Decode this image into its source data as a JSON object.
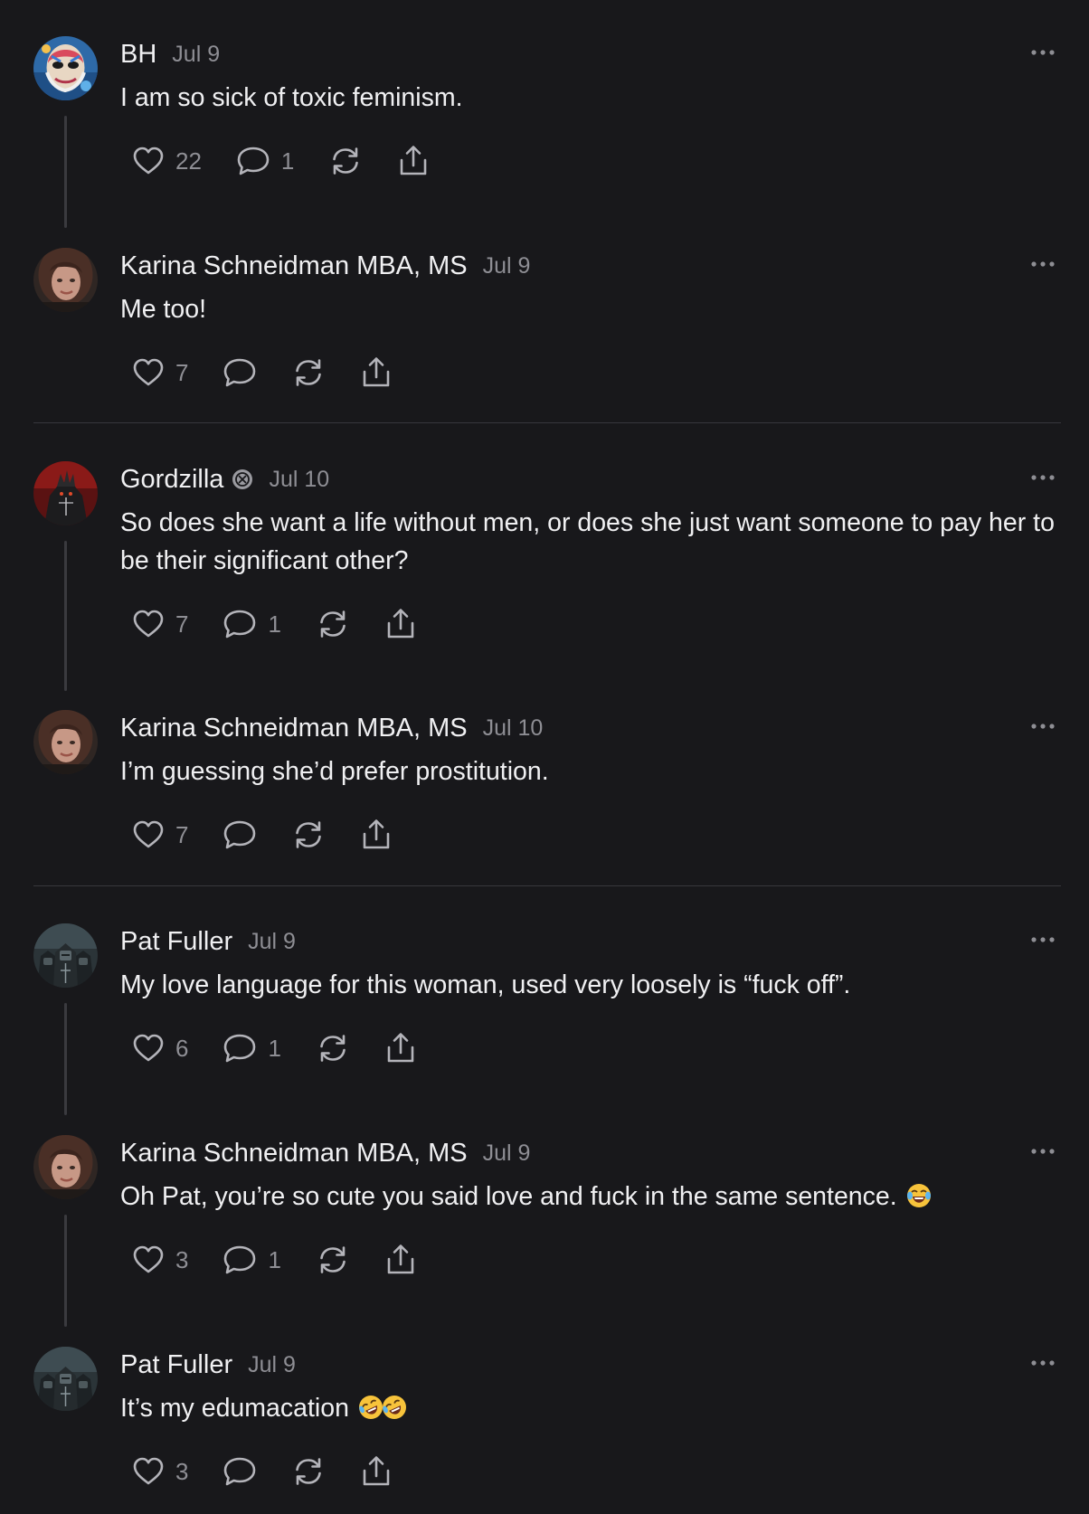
{
  "comments": [
    {
      "author": "BH",
      "date": "Jul 9",
      "text": "I am so sick of toxic feminism.",
      "likes": "22",
      "replies": "1",
      "avatar": "bh-painted-face-avatar"
    },
    {
      "author": "Karina Schneidman MBA, MS",
      "date": "Jul 9",
      "text": "Me too!",
      "likes": "7",
      "replies": "",
      "avatar": "karina-avatar"
    },
    {
      "author": "Gordzilla",
      "date": "Jul 10",
      "text": "So does she want a life without men, or does she just want someone to pay her to be their significant other?",
      "likes": "7",
      "replies": "1",
      "avatar": "gordzilla-avatar",
      "badge": "verified-badge-icon"
    },
    {
      "author": "Karina Schneidman MBA, MS",
      "date": "Jul 10",
      "text": "I’m guessing she’d prefer prostitution.",
      "likes": "7",
      "replies": "",
      "avatar": "karina-avatar"
    },
    {
      "author": "Pat Fuller",
      "date": "Jul 9",
      "text": "My love language for this woman, used very loosely is “fuck off”.",
      "likes": "6",
      "replies": "1",
      "avatar": "pat-fuller-knights-avatar"
    },
    {
      "author": "Karina Schneidman MBA, MS",
      "date": "Jul 9",
      "text": "Oh Pat, you’re so cute you said love and fuck in the same sentence.",
      "emoji": "face-with-tears-of-joy",
      "likes": "3",
      "replies": "1",
      "avatar": "karina-avatar"
    },
    {
      "author": "Pat Fuller",
      "date": "Jul 9",
      "text": "It’s my edumacation",
      "emoji": "rolling-on-floor-laughing x2",
      "likes": "3",
      "replies": "",
      "avatar": "pat-fuller-knights-avatar"
    }
  ],
  "icons": {
    "like": "heart-icon",
    "reply": "comment-icon",
    "restack": "restack-icon",
    "share": "share-icon",
    "more": "more-options-icon"
  },
  "colors": {
    "background": "#18181b",
    "text": "#f0f0f2",
    "muted": "#8e8e94",
    "divider": "#37373c"
  }
}
